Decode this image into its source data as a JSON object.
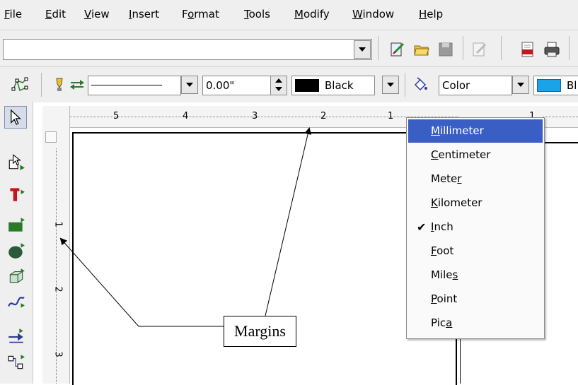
{
  "menubar": {
    "items": [
      "File",
      "Edit",
      "View",
      "Insert",
      "Format",
      "Tools",
      "Modify",
      "Window",
      "Help"
    ],
    "mnemonics": [
      "F",
      "E",
      "V",
      "I",
      "o",
      "T",
      "M",
      "W",
      "H"
    ]
  },
  "line_toolbar": {
    "line_width": "0.00\"",
    "line_color": "Black",
    "line_color_hex": "#000000",
    "area_style": "Color",
    "area_color_name_partial": "Bl",
    "area_color_hex": "#1aa3e6"
  },
  "ruler_h": {
    "numbers": [
      "5",
      "4",
      "3",
      "2",
      "1",
      "1"
    ]
  },
  "ruler_v": {
    "numbers": [
      "1",
      "2",
      "3"
    ]
  },
  "unit_menu": {
    "items": [
      {
        "label": "Millimeter",
        "mnemonic": "M",
        "selected": true,
        "checked": false
      },
      {
        "label": "Centimeter",
        "mnemonic": "C",
        "selected": false,
        "checked": false
      },
      {
        "label": "Meter",
        "mnemonic": "r",
        "selected": false,
        "checked": false
      },
      {
        "label": "Kilometer",
        "mnemonic": "K",
        "selected": false,
        "checked": false
      },
      {
        "label": "Inch",
        "mnemonic": "I",
        "selected": false,
        "checked": true
      },
      {
        "label": "Foot",
        "mnemonic": "F",
        "selected": false,
        "checked": false
      },
      {
        "label": "Miles",
        "mnemonic": "s",
        "selected": false,
        "checked": false
      },
      {
        "label": "Point",
        "mnemonic": "P",
        "selected": false,
        "checked": false
      },
      {
        "label": "Pica",
        "mnemonic": "a",
        "selected": false,
        "checked": false
      }
    ]
  },
  "annotation": {
    "label": "Margins"
  }
}
